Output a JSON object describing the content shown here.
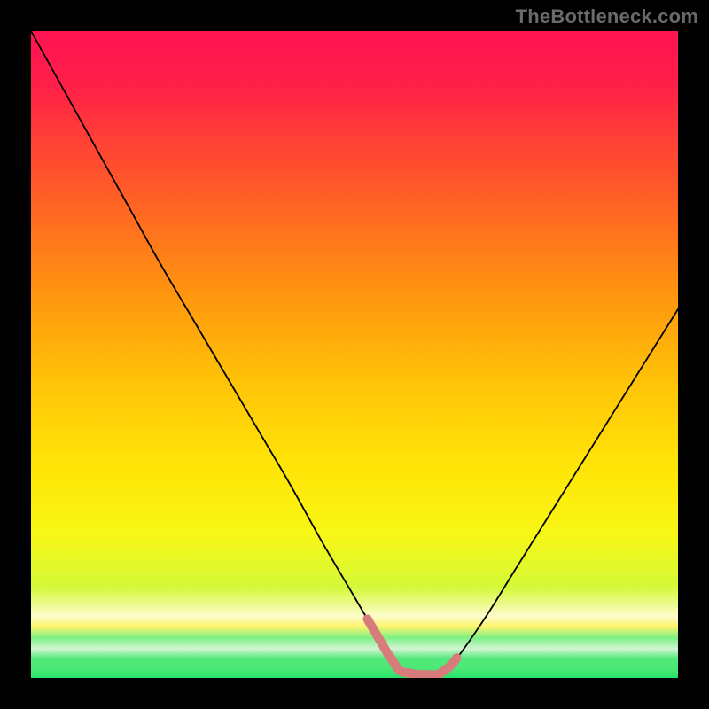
{
  "watermark": "TheBottleneck.com",
  "chart_data": {
    "type": "line",
    "title": "",
    "xlabel": "",
    "ylabel": "",
    "xlim": [
      0,
      100
    ],
    "ylim": [
      0,
      100
    ],
    "series": [
      {
        "name": "curve",
        "x": [
          0,
          5,
          10,
          15,
          20,
          25,
          30,
          35,
          40,
          45,
          50,
          55,
          57,
          60,
          63,
          65,
          70,
          75,
          80,
          85,
          90,
          95,
          100
        ],
        "values": [
          100,
          91,
          82,
          73,
          64,
          55.5,
          47,
          38.5,
          30,
          21,
          12.5,
          4,
          1,
          0.5,
          0.5,
          2,
          9,
          17,
          25,
          33,
          41,
          49,
          57
        ]
      }
    ],
    "annotations": [
      {
        "name": "bottom-highlight",
        "x_start": 52,
        "x_end": 66,
        "color": "#d77b7b"
      }
    ],
    "background_gradient": {
      "stops": [
        {
          "offset": 0.0,
          "color": "#ff1452"
        },
        {
          "offset": 0.08,
          "color": "#ff1e49"
        },
        {
          "offset": 0.18,
          "color": "#ff4433"
        },
        {
          "offset": 0.3,
          "color": "#ff6f1f"
        },
        {
          "offset": 0.42,
          "color": "#ff9a0e"
        },
        {
          "offset": 0.55,
          "color": "#ffc507"
        },
        {
          "offset": 0.68,
          "color": "#ffe607"
        },
        {
          "offset": 0.78,
          "color": "#f7f716"
        },
        {
          "offset": 0.86,
          "color": "#d4f838"
        },
        {
          "offset": 0.905,
          "color": "#fdfccb"
        },
        {
          "offset": 0.92,
          "color": "#fff56c"
        },
        {
          "offset": 0.938,
          "color": "#7df085"
        },
        {
          "offset": 0.955,
          "color": "#d2f5d2"
        },
        {
          "offset": 0.97,
          "color": "#53e87a"
        },
        {
          "offset": 0.985,
          "color": "#4ee877"
        },
        {
          "offset": 1.0,
          "color": "#28e36a"
        }
      ]
    }
  }
}
